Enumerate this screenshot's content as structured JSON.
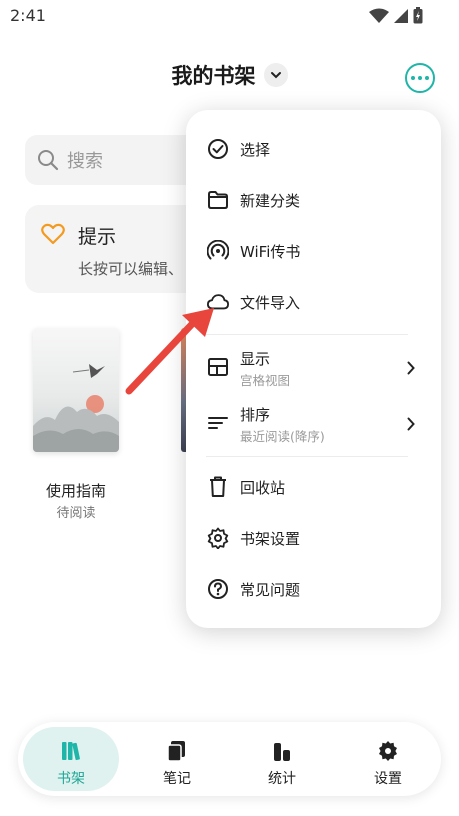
{
  "status_bar": {
    "time": "2:41"
  },
  "header": {
    "title": "我的书架"
  },
  "search": {
    "placeholder": "搜索"
  },
  "tip": {
    "title": "提示",
    "text": "长按可以编辑、"
  },
  "books": [
    {
      "title": "使用指南",
      "status": "待阅读"
    }
  ],
  "menu": {
    "items": [
      {
        "label": "选择",
        "icon": "check-circle-icon"
      },
      {
        "label": "新建分类",
        "icon": "folder-icon"
      },
      {
        "label": "WiFi传书",
        "icon": "wifi-broadcast-icon"
      },
      {
        "label": "文件导入",
        "icon": "cloud-icon"
      },
      {
        "label": "显示",
        "sublabel": "宫格视图",
        "icon": "grid-layout-icon"
      },
      {
        "label": "排序",
        "sublabel": "最近阅读(降序)",
        "icon": "sort-icon"
      },
      {
        "label": "回收站",
        "icon": "trash-icon"
      },
      {
        "label": "书架设置",
        "icon": "gear-icon"
      },
      {
        "label": "常见问题",
        "icon": "question-icon"
      }
    ]
  },
  "bottom_nav": {
    "items": [
      {
        "label": "书架",
        "icon": "books-icon",
        "active": true
      },
      {
        "label": "笔记",
        "icon": "notes-icon",
        "active": false
      },
      {
        "label": "统计",
        "icon": "stats-icon",
        "active": false
      },
      {
        "label": "设置",
        "icon": "gear-icon",
        "active": false
      }
    ]
  },
  "colors": {
    "accent": "#1fb5a8",
    "arrow": "#e8463c",
    "heart": "#f39a1f"
  }
}
